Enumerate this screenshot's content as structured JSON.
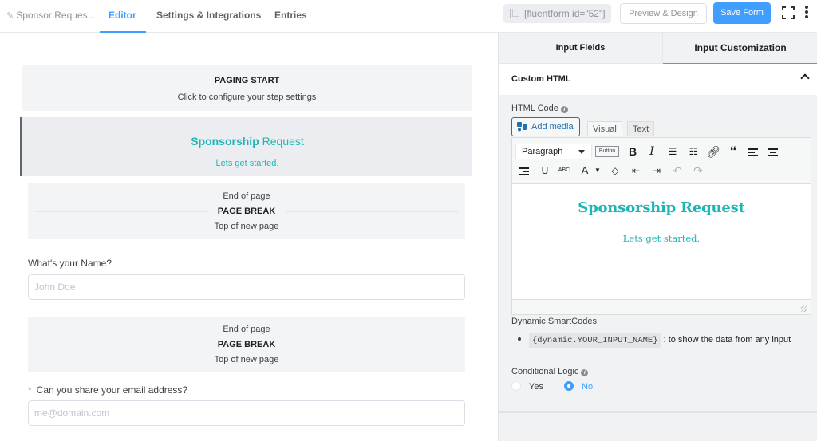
{
  "header": {
    "form_title": "Sponsor Reques...",
    "tabs": [
      {
        "label": "Editor",
        "active": true
      },
      {
        "label": "Settings & Integrations",
        "active": false
      },
      {
        "label": "Entries",
        "active": false
      }
    ],
    "shortcode": "[fluentform id=\"52\"]",
    "preview_label": "Preview & Design",
    "save_label": "Save Form",
    "accent_color": "#409eff"
  },
  "canvas": {
    "paging_start": {
      "title": "PAGING START",
      "subtitle": "Click to configure your step settings"
    },
    "custom_html": {
      "heading_bold": "Sponsorship",
      "heading_rest": " Request",
      "subtext": "Lets get started.",
      "color": "#1fb5b5"
    },
    "page_breaks": [
      {
        "top": "End of page",
        "title": "PAGE BREAK",
        "bottom": "Top of new page"
      },
      {
        "top": "End of page",
        "title": "PAGE BREAK",
        "bottom": "Top of new page"
      }
    ],
    "fields": [
      {
        "label": "What's your Name?",
        "required": false,
        "placeholder": "John Doe"
      },
      {
        "label": "Can you share your email address?",
        "required": true,
        "required_mark": "*",
        "placeholder": "me@domain.com"
      }
    ]
  },
  "panel": {
    "tabs": [
      {
        "label": "Input Fields",
        "active": false
      },
      {
        "label": "Input Customization",
        "active": true
      }
    ],
    "section_title": "Custom HTML",
    "html_code_label": "HTML Code",
    "add_media_label": "Add media",
    "editor_tabs": [
      {
        "label": "Visual",
        "active": true
      },
      {
        "label": "Text",
        "active": false
      }
    ],
    "format_select": "Paragraph",
    "button_tag_label": "Button",
    "content": {
      "heading": "Sponsorship Request",
      "paragraph": "Lets get started."
    },
    "smartcodes_label": "Dynamic SmartCodes",
    "smartcode": "{dynamic.YOUR_INPUT_NAME}",
    "smartcode_desc": " : to show the data from any input",
    "conditional_label": "Conditional Logic",
    "conditional_options": [
      {
        "label": "Yes",
        "selected": false
      },
      {
        "label": "No",
        "selected": true
      }
    ]
  }
}
